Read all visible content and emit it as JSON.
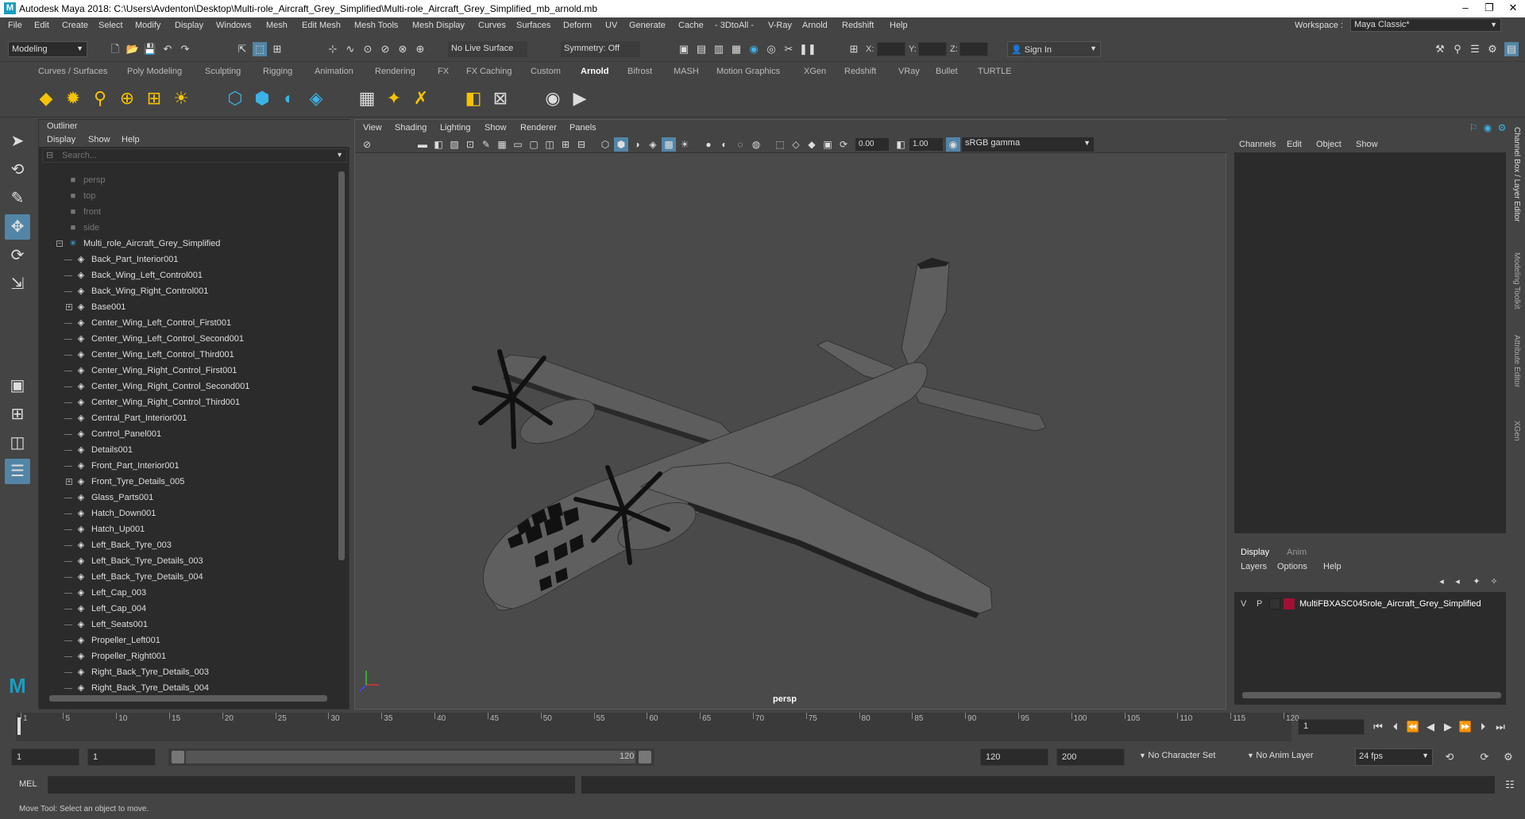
{
  "app": {
    "title": "Autodesk Maya 2018: C:\\Users\\Avdenton\\Desktop\\Multi-role_Aircraft_Grey_Simplified\\Multi-role_Aircraft_Grey_Simplified_mb_arnold.mb",
    "logo_letter": "M",
    "window_buttons": [
      "–",
      "❐",
      "✕"
    ]
  },
  "menubar": [
    "File",
    "Edit",
    "Create",
    "Select",
    "Modify",
    "Display",
    "Windows",
    "Mesh",
    "Edit Mesh",
    "Mesh Tools",
    "Mesh Display",
    "Curves",
    "Surfaces",
    "Deform",
    "UV",
    "Generate",
    "Cache",
    "- 3DtoAll -",
    "V-Ray",
    "Arnold",
    "Redshift",
    "Help"
  ],
  "workspace": {
    "label": "Workspace :",
    "value": "Maya Classic*"
  },
  "statusline": {
    "mode": "Modeling",
    "live_surface": "No Live Surface",
    "symmetry": "Symmetry: Off",
    "x_label": "X:",
    "y_label": "Y:",
    "z_label": "Z:",
    "sign_in": "Sign In"
  },
  "shelf_tabs": [
    "Curves / Surfaces",
    "Poly Modeling",
    "Sculpting",
    "Rigging",
    "Animation",
    "Rendering",
    "FX",
    "FX Caching",
    "Custom",
    "Arnold",
    "Bifrost",
    "MASH",
    "Motion Graphics",
    "XGen",
    "Redshift",
    "VRay",
    "Bullet",
    "TURTLE"
  ],
  "shelf_active": "Arnold",
  "outliner": {
    "title": "Outliner",
    "menu": [
      "Display",
      "Show",
      "Help"
    ],
    "search_placeholder": "Search...",
    "cameras": [
      "persp",
      "top",
      "front",
      "side"
    ],
    "root": "Multi_role_Aircraft_Grey_Simplified",
    "items": [
      {
        "name": "Back_Part_Interior001",
        "expandable": false
      },
      {
        "name": "Back_Wing_Left_Control001",
        "expandable": false
      },
      {
        "name": "Back_Wing_Right_Control001",
        "expandable": false
      },
      {
        "name": "Base001",
        "expandable": true
      },
      {
        "name": "Center_Wing_Left_Control_First001",
        "expandable": false
      },
      {
        "name": "Center_Wing_Left_Control_Second001",
        "expandable": false
      },
      {
        "name": "Center_Wing_Left_Control_Third001",
        "expandable": false
      },
      {
        "name": "Center_Wing_Right_Control_First001",
        "expandable": false
      },
      {
        "name": "Center_Wing_Right_Control_Second001",
        "expandable": false
      },
      {
        "name": "Center_Wing_Right_Control_Third001",
        "expandable": false
      },
      {
        "name": "Central_Part_Interior001",
        "expandable": false
      },
      {
        "name": "Control_Panel001",
        "expandable": false
      },
      {
        "name": "Details001",
        "expandable": false
      },
      {
        "name": "Front_Part_Interior001",
        "expandable": false
      },
      {
        "name": "Front_Tyre_Details_005",
        "expandable": true
      },
      {
        "name": "Glass_Parts001",
        "expandable": false
      },
      {
        "name": "Hatch_Down001",
        "expandable": false
      },
      {
        "name": "Hatch_Up001",
        "expandable": false
      },
      {
        "name": "Left_Back_Tyre_003",
        "expandable": false
      },
      {
        "name": "Left_Back_Tyre_Details_003",
        "expandable": false
      },
      {
        "name": "Left_Back_Tyre_Details_004",
        "expandable": false
      },
      {
        "name": "Left_Cap_003",
        "expandable": false
      },
      {
        "name": "Left_Cap_004",
        "expandable": false
      },
      {
        "name": "Left_Seats001",
        "expandable": false
      },
      {
        "name": "Propeller_Left001",
        "expandable": false
      },
      {
        "name": "Propeller_Right001",
        "expandable": false
      },
      {
        "name": "Right_Back_Tyre_Details_003",
        "expandable": false
      },
      {
        "name": "Right_Back_Tyre_Details_004",
        "expandable": false
      }
    ]
  },
  "viewport": {
    "menu": [
      "View",
      "Shading",
      "Lighting",
      "Show",
      "Renderer",
      "Panels"
    ],
    "exposure": "0.00",
    "gamma": "1.00",
    "color_space": "sRGB gamma",
    "camera": "persp"
  },
  "channel_box": {
    "menu": [
      "Channels",
      "Edit",
      "Object",
      "Show"
    ]
  },
  "layer_editor": {
    "tabs": [
      "Display",
      "Anim"
    ],
    "menu": [
      "Layers",
      "Options",
      "Help"
    ],
    "layer": {
      "v": "V",
      "p": "P",
      "name": "MultiFBXASC045role_Aircraft_Grey_Simplified",
      "color": "#a01035"
    }
  },
  "side_tabs": [
    "Channel Box / Layer Editor",
    "Modeling Toolkit",
    "Attribute Editor",
    "XGen"
  ],
  "timeline": {
    "ticks": [
      "1",
      "5",
      "10",
      "15",
      "20",
      "25",
      "30",
      "35",
      "40",
      "45",
      "50",
      "55",
      "60",
      "65",
      "70",
      "75",
      "80",
      "85",
      "90",
      "95",
      "100",
      "105",
      "110",
      "115",
      "120"
    ],
    "current_frame": "1"
  },
  "range": {
    "start": "1",
    "anim_start": "1",
    "slider_start": "1",
    "slider_end": "120",
    "end": "120",
    "anim_end": "200",
    "character_set": "No Character Set",
    "anim_layer": "No Anim Layer",
    "fps": "24 fps"
  },
  "cmdline": {
    "label": "MEL"
  },
  "helpline": {
    "text": "Move Tool: Select an object to move."
  }
}
